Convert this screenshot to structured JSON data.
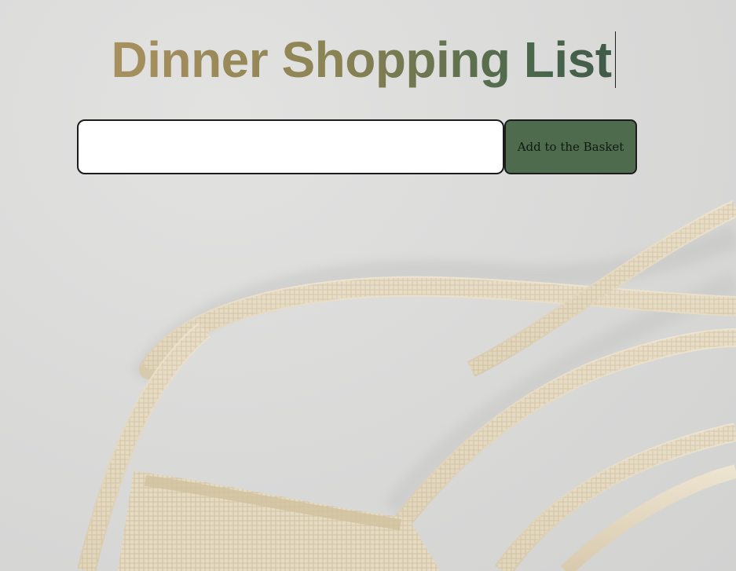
{
  "header": {
    "title": "Dinner Shopping List"
  },
  "form": {
    "item_input_value": "",
    "item_input_placeholder": "",
    "add_button_label": "Add to the Basket"
  },
  "colors": {
    "title_gradient_start": "#a8905f",
    "title_gradient_end": "#3f5a49",
    "button_background": "#4f6b4e",
    "page_background": "#dcdcdc"
  },
  "background": {
    "image_subject": "mesh-shopping-bag-icon"
  }
}
